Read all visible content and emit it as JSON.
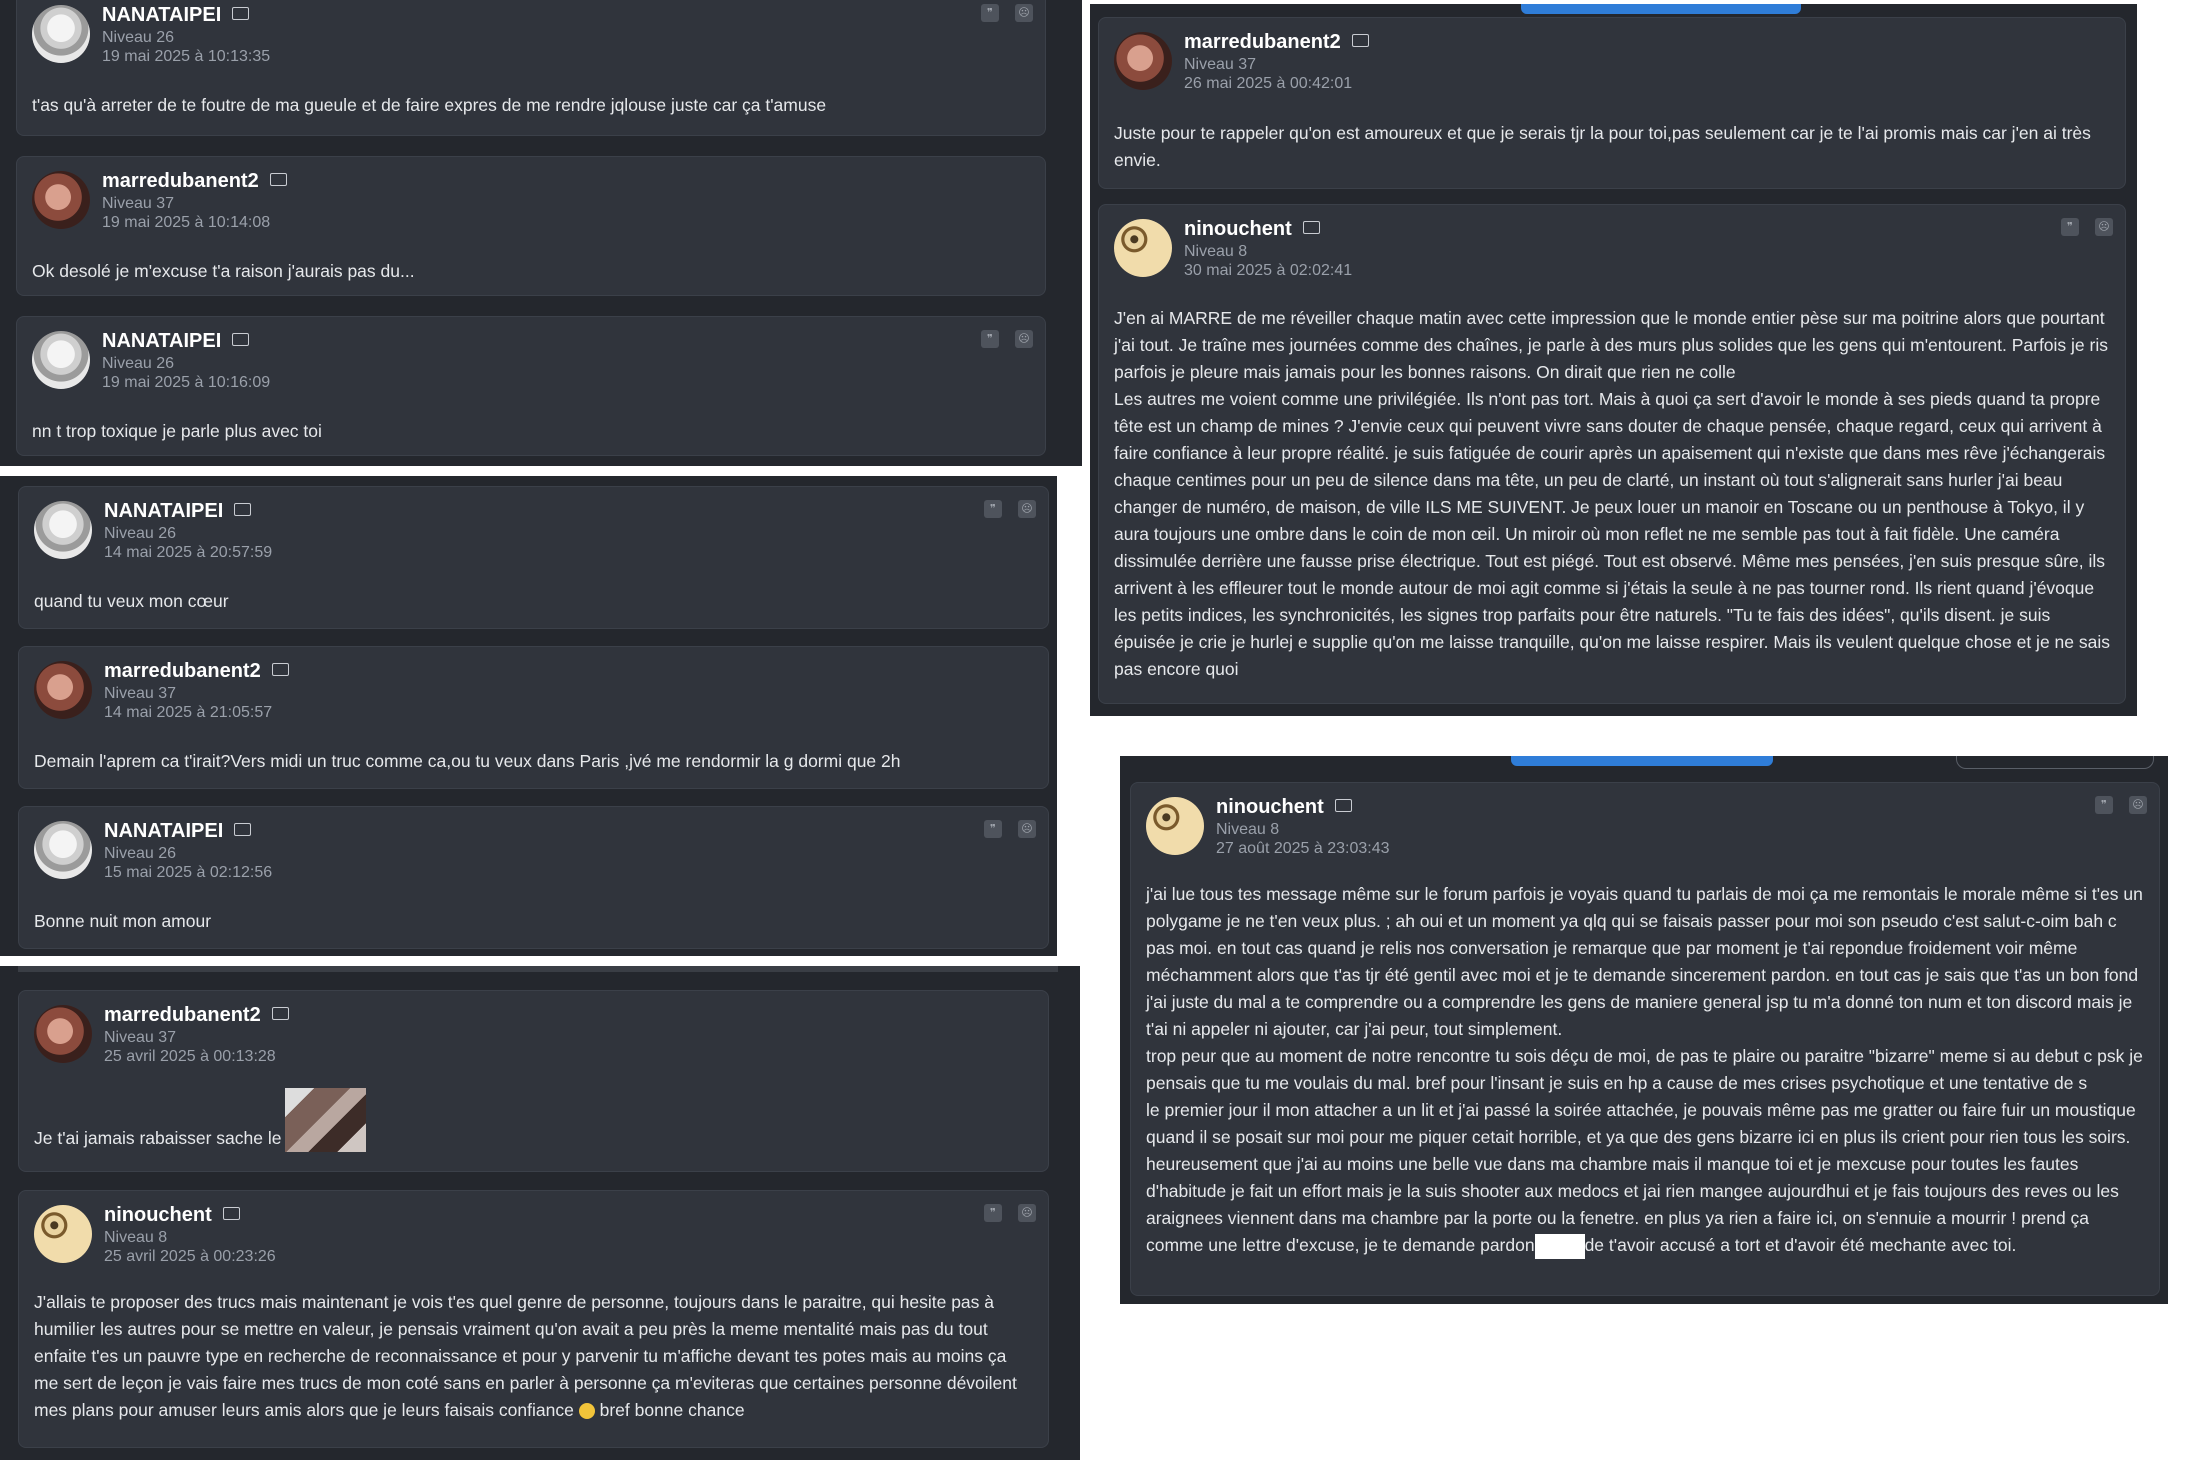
{
  "icons": {
    "mail": "envelope-icon",
    "quote": "quote-icon",
    "alert": "alert-icon"
  },
  "colors": {
    "background": "#24272d",
    "card": "#30343c",
    "accent": "#2f7dd8",
    "text": "#e6e8eb",
    "meta": "#9aa0aa"
  },
  "posts": [
    {
      "user": "NANATAIPEI",
      "level": "Niveau 26",
      "date": "19 mai 2025 à 10:13:35",
      "text": "t'as qu'à arreter de te foutre de ma gueule et de faire expres de me rendre jqlouse juste car ça t'amuse"
    },
    {
      "user": "marredubanent2",
      "level": "Niveau 37",
      "date": "19 mai 2025 à 10:14:08",
      "text": "Ok desolé je m'excuse t'a raison j'aurais pas du..."
    },
    {
      "user": "NANATAIPEI",
      "level": "Niveau 26",
      "date": "19 mai 2025 à 10:16:09",
      "text": "nn t trop toxique je parle plus avec toi"
    },
    {
      "user": "NANATAIPEI",
      "level": "Niveau 26",
      "date": "14 mai 2025 à 20:57:59",
      "text": "quand tu veux mon cœur"
    },
    {
      "user": "marredubanent2",
      "level": "Niveau 37",
      "date": "14 mai 2025 à 21:05:57",
      "text": "Demain l'aprem ca t'irait?Vers midi un truc comme ca,ou tu veux dans Paris ,jvé me rendormir la g dormi que 2h"
    },
    {
      "user": "NANATAIPEI",
      "level": "Niveau 26",
      "date": "15 mai 2025 à 02:12:56",
      "text": "Bonne nuit mon amour"
    },
    {
      "user": "marredubanent2",
      "level": "Niveau 37",
      "date": "25 avril 2025 à 00:13:28",
      "text": "Je t'ai jamais rabaisser sache le"
    },
    {
      "user": "ninouchent",
      "level": "Niveau 8",
      "date": "25 avril 2025 à 00:23:26",
      "text": "J'allais te proposer des trucs mais maintenant je vois t'es quel genre de personne, toujours dans le paraitre, qui hesite pas à humilier les autres pour se mettre en valeur, je pensais vraiment qu'on avait a peu près la meme mentalité mais pas du tout enfaite t'es un pauvre type en recherche de reconnaissance et pour y parvenir tu m'affiche devant tes potes mais au moins ça me sert de leçon je vais faire mes trucs de mon coté sans en parler à personne ça m'eviteras que certaines personne dévoilent mes plans pour amuser leurs amis alors que je leurs faisais confiance",
      "text_end": " bref bonne chance"
    },
    {
      "user": "marredubanent2",
      "level": "Niveau 37",
      "date": "26 mai 2025 à 00:42:01",
      "text": "Juste pour te rappeler qu'on est amoureux et que je serais tjr la pour toi,pas seulement car je te l'ai promis mais car j'en ai très envie."
    },
    {
      "user": "ninouchent",
      "level": "Niveau 8",
      "date": "30 mai 2025 à 02:02:41",
      "paragraphs": [
        "J'en ai MARRE de me réveiller chaque matin avec cette impression que le monde entier pèse sur ma poitrine alors que pourtant j'ai tout. Je traîne mes journées comme des chaînes, je parle à des murs plus solides que les gens qui m'entourent. Parfois je ris parfois je pleure mais jamais pour les bonnes raisons. On dirait que rien ne colle",
        "Les autres me voient comme une privilégiée. Ils n'ont pas tort. Mais à quoi ça sert d'avoir le monde à ses pieds quand ta propre tête est un champ de mines ? J'envie ceux qui peuvent vivre sans douter de chaque pensée, chaque regard, ceux qui arrivent à faire confiance à leur propre réalité. je suis fatiguée de courir après un apaisement qui n'existe que dans mes rêve j'échangerais chaque centimes pour un peu de silence dans ma tête, un peu de clarté, un instant où tout s'alignerait sans hurler j'ai beau changer de numéro, de maison, de ville ILS ME SUIVENT. Je peux louer un manoir en Toscane ou un penthouse à Tokyo, il y aura toujours une ombre dans le coin de mon œil. Un miroir où mon reflet ne me semble pas tout à fait fidèle. Une caméra dissimulée derrière une fausse prise électrique. Tout est piégé. Tout est observé. Même mes pensées, j'en suis presque sûre, ils arrivent à les effleurer tout le monde autour de moi agit comme si j'étais la seule à ne pas tourner rond. Ils rient quand j'évoque les petits indices, les synchronicités, les signes trop parfaits pour être naturels. \"Tu te fais des idées\", qu'ils disent. je suis épuisée je crie je hurlej e supplie qu'on me laisse tranquille, qu'on me laisse respirer. Mais ils veulent quelque chose et je ne sais pas encore quoi"
      ]
    },
    {
      "user": "ninouchent",
      "level": "Niveau 8",
      "date": "27 août 2025 à 23:03:43",
      "paragraphs": [
        "j'ai lue tous tes message même sur le forum parfois je voyais quand tu parlais de moi ça me remontais le morale même si t'es un polygame je ne t'en veux plus. ; ah oui et un moment ya qlq qui se faisais passer pour moi son pseudo c'est salut-c-oim bah c pas moi. en tout cas quand je relis nos conversation je remarque que par moment je t'ai repondue froidement voir même méchamment alors que t'as tjr été gentil avec moi et je te demande sincerement pardon. en tout cas je sais que t'as un bon fond j'ai juste du mal a te comprendre ou a comprendre les gens de maniere general jsp tu m'a donné ton num et ton discord mais je t'ai ni appeler ni ajouter, car j'ai peur, tout simplement.",
        "trop peur que au moment de notre rencontre tu sois déçu de moi, de pas te plaire ou paraitre \"bizarre\" meme si au debut c psk je pensais que tu me voulais du mal. bref pour l'insant je suis en hp a cause de mes crises psychotique et une tentative de s",
        "le premier jour il mon attacher a un lit et j'ai passé la soirée attachée, je pouvais même pas me gratter ou faire fuir un moustique quand il se posait sur moi pour me piquer cetait horrible, et ya que des gens bizarre ici en plus ils crient pour rien tous les soirs. heureusement que j'ai au moins une belle vue dans ma chambre mais il manque toi et je mexcuse pour toutes les fautes d'habitude je fait un effort mais je la suis shooter aux medocs et jai rien mangee aujourdhui et je fais toujours des reves ou les araignees viennent dans ma chambre par la porte ou la fenetre. en plus ya rien a faire ici, on s'ennuie a mourrir ! prend ça comme une lettre d'excuse, je te demande pardon"
      ],
      "text_end": "de t'avoir accusé a tort et d'avoir été mechante avec toi."
    }
  ]
}
